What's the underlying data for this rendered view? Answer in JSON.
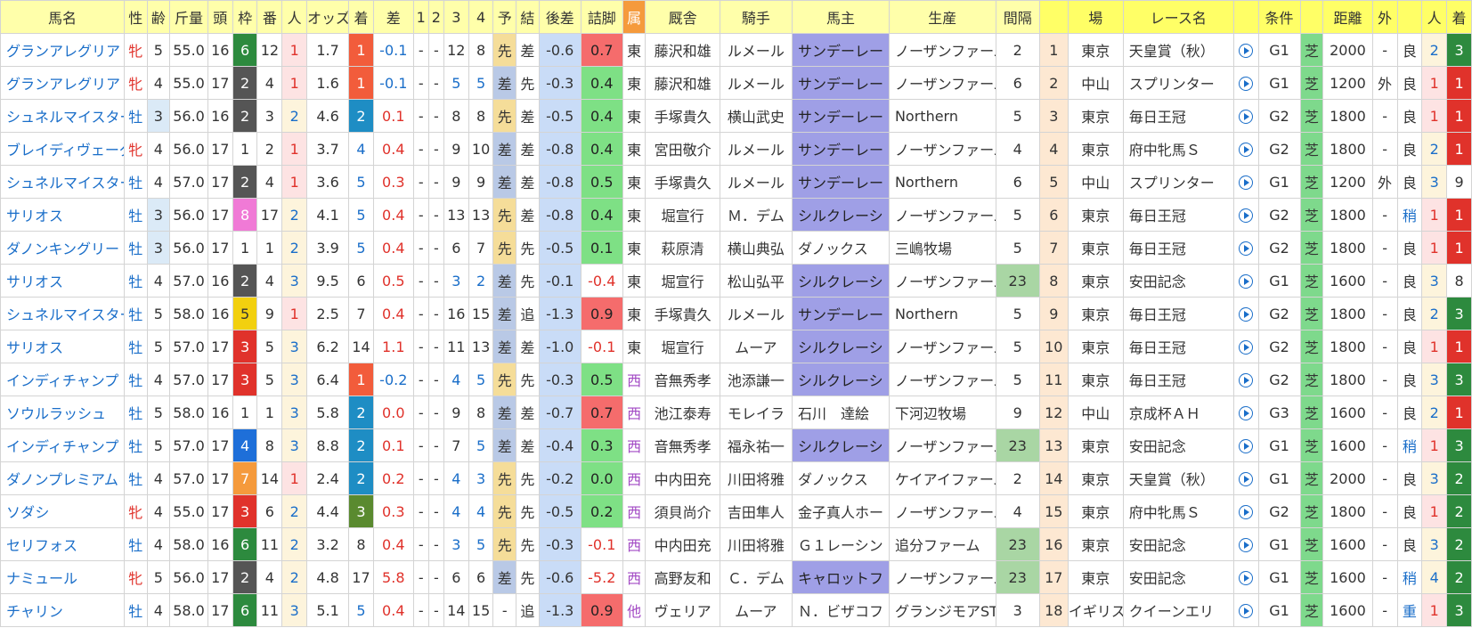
{
  "headers": [
    "馬名",
    "性",
    "齢",
    "斤量",
    "頭",
    "枠",
    "番",
    "人",
    "オッズ",
    "着",
    "差",
    "1",
    "2",
    "3",
    "4",
    "予",
    "結",
    "後差",
    "詰脚",
    "属",
    "厩舎",
    "騎手",
    "馬主",
    "生産",
    "間隔",
    "",
    "場",
    "レース名",
    "",
    "条件",
    "",
    "距離",
    "外",
    "",
    "人",
    "着"
  ],
  "colors": {
    "frame": {
      "1": "#ffffff",
      "2": "#555555",
      "3": "#e0322b",
      "4": "#1e6fd9",
      "5": "#f2d00f",
      "6": "#2d8a3e",
      "7": "#f59a3c",
      "8": "#f07ad6"
    },
    "frame_text": {
      "1": "#333333",
      "2": "#ffffff",
      "3": "#ffffff",
      "4": "#ffffff",
      "5": "#333333",
      "6": "#ffffff",
      "7": "#ffffff",
      "8": "#ffffff"
    }
  },
  "rows": [
    {
      "name": "グランアレグリア",
      "sex": "牝",
      "age": "5",
      "weight": "55.0",
      "heads": "16",
      "frame": "6",
      "num": "12",
      "pop": "1",
      "odds": "1.7",
      "finish": "1",
      "diff": "-0.1",
      "c1": "-",
      "c2": "-",
      "c3": "12",
      "c4": "8",
      "pred": "先",
      "res": "差",
      "gosa": "-0.6",
      "tsume": "0.7",
      "zoku": "東",
      "stable": "藤沢和雄",
      "jockey": "ルメール",
      "owner": "サンデーレー",
      "breeder": "ノーザンファーム",
      "interval": "2",
      "idx": "1",
      "venue": "東京",
      "race": "天皇賞（秋）",
      "grade": "G1",
      "surface": "芝",
      "dist": "2000",
      "out": "-",
      "baba": "良",
      "rpop": "2",
      "rfin": "3"
    },
    {
      "name": "グランアレグリア",
      "sex": "牝",
      "age": "4",
      "weight": "55.0",
      "heads": "17",
      "frame": "2",
      "num": "4",
      "pop": "1",
      "odds": "1.6",
      "finish": "1",
      "diff": "-0.1",
      "c1": "-",
      "c2": "-",
      "c3": "5",
      "c4": "5",
      "pred": "差",
      "res": "先",
      "gosa": "-0.3",
      "tsume": "0.4",
      "zoku": "東",
      "stable": "藤沢和雄",
      "jockey": "ルメール",
      "owner": "サンデーレー",
      "breeder": "ノーザンファーム",
      "interval": "6",
      "idx": "2",
      "venue": "中山",
      "race": "スプリンター",
      "grade": "G1",
      "surface": "芝",
      "dist": "1200",
      "out": "外",
      "baba": "良",
      "rpop": "1",
      "rfin": "1"
    },
    {
      "name": "シュネルマイスター",
      "sex": "牡",
      "age": "3",
      "weight": "56.0",
      "heads": "16",
      "frame": "2",
      "num": "3",
      "pop": "2",
      "odds": "4.6",
      "finish": "2",
      "diff": "0.1",
      "c1": "-",
      "c2": "-",
      "c3": "8",
      "c4": "8",
      "pred": "先",
      "res": "差",
      "gosa": "-0.5",
      "tsume": "0.4",
      "zoku": "東",
      "stable": "手塚貴久",
      "jockey": "横山武史",
      "owner": "サンデーレー",
      "breeder": "Northern",
      "interval": "5",
      "idx": "3",
      "venue": "東京",
      "race": "毎日王冠",
      "grade": "G2",
      "surface": "芝",
      "dist": "1800",
      "out": "-",
      "baba": "良",
      "rpop": "1",
      "rfin": "1"
    },
    {
      "name": "ブレイディヴェーグ",
      "sex": "牝",
      "age": "4",
      "weight": "56.0",
      "heads": "17",
      "frame": "1",
      "num": "2",
      "pop": "1",
      "odds": "3.7",
      "finish": "4",
      "diff": "0.4",
      "c1": "-",
      "c2": "-",
      "c3": "9",
      "c4": "10",
      "pred": "差",
      "res": "差",
      "gosa": "-0.8",
      "tsume": "0.4",
      "zoku": "東",
      "stable": "宮田敬介",
      "jockey": "ルメール",
      "owner": "サンデーレー",
      "breeder": "ノーザンファーム",
      "interval": "4",
      "idx": "4",
      "venue": "東京",
      "race": "府中牝馬Ｓ",
      "grade": "G2",
      "surface": "芝",
      "dist": "1800",
      "out": "-",
      "baba": "良",
      "rpop": "2",
      "rfin": "1"
    },
    {
      "name": "シュネルマイスター",
      "sex": "牡",
      "age": "4",
      "weight": "57.0",
      "heads": "17",
      "frame": "2",
      "num": "4",
      "pop": "1",
      "odds": "3.6",
      "finish": "5",
      "diff": "0.3",
      "c1": "-",
      "c2": "-",
      "c3": "9",
      "c4": "9",
      "pred": "差",
      "res": "差",
      "gosa": "-0.8",
      "tsume": "0.5",
      "zoku": "東",
      "stable": "手塚貴久",
      "jockey": "ルメール",
      "owner": "サンデーレー",
      "breeder": "Northern",
      "interval": "6",
      "idx": "5",
      "venue": "中山",
      "race": "スプリンター",
      "grade": "G1",
      "surface": "芝",
      "dist": "1200",
      "out": "外",
      "baba": "良",
      "rpop": "3",
      "rfin": "9"
    },
    {
      "name": "サリオス",
      "sex": "牡",
      "age": "3",
      "weight": "56.0",
      "heads": "17",
      "frame": "8",
      "num": "17",
      "pop": "2",
      "odds": "4.1",
      "finish": "5",
      "diff": "0.4",
      "c1": "-",
      "c2": "-",
      "c3": "13",
      "c4": "13",
      "pred": "先",
      "res": "差",
      "gosa": "-0.8",
      "tsume": "0.4",
      "zoku": "東",
      "stable": "堀宣行",
      "jockey": "Ｍ．デム",
      "owner": "シルクレーシ",
      "breeder": "ノーザンファーム",
      "interval": "5",
      "idx": "6",
      "venue": "東京",
      "race": "毎日王冠",
      "grade": "G2",
      "surface": "芝",
      "dist": "1800",
      "out": "-",
      "baba": "稍",
      "rpop": "1",
      "rfin": "1"
    },
    {
      "name": "ダノンキングリー",
      "sex": "牡",
      "age": "3",
      "weight": "56.0",
      "heads": "17",
      "frame": "1",
      "num": "1",
      "pop": "2",
      "odds": "3.9",
      "finish": "5",
      "diff": "0.4",
      "c1": "-",
      "c2": "-",
      "c3": "6",
      "c4": "7",
      "pred": "先",
      "res": "先",
      "gosa": "-0.5",
      "tsume": "0.1",
      "zoku": "東",
      "stable": "萩原清",
      "jockey": "横山典弘",
      "owner": "ダノックス",
      "breeder": "三嶋牧場",
      "interval": "5",
      "idx": "7",
      "venue": "東京",
      "race": "毎日王冠",
      "grade": "G2",
      "surface": "芝",
      "dist": "1800",
      "out": "-",
      "baba": "良",
      "rpop": "1",
      "rfin": "1"
    },
    {
      "name": "サリオス",
      "sex": "牡",
      "age": "4",
      "weight": "57.0",
      "heads": "16",
      "frame": "2",
      "num": "4",
      "pop": "3",
      "odds": "9.5",
      "finish": "6",
      "diff": "0.5",
      "c1": "-",
      "c2": "-",
      "c3": "3",
      "c4": "2",
      "pred": "差",
      "res": "先",
      "gosa": "-0.1",
      "tsume": "-0.4",
      "zoku": "東",
      "stable": "堀宣行",
      "jockey": "松山弘平",
      "owner": "シルクレーシ",
      "breeder": "ノーザンファーム",
      "interval": "23",
      "idx": "8",
      "venue": "東京",
      "race": "安田記念",
      "grade": "G1",
      "surface": "芝",
      "dist": "1600",
      "out": "-",
      "baba": "良",
      "rpop": "3",
      "rfin": "8"
    },
    {
      "name": "シュネルマイスター",
      "sex": "牡",
      "age": "5",
      "weight": "58.0",
      "heads": "16",
      "frame": "5",
      "num": "9",
      "pop": "1",
      "odds": "2.5",
      "finish": "7",
      "diff": "0.4",
      "c1": "-",
      "c2": "-",
      "c3": "16",
      "c4": "15",
      "pred": "差",
      "res": "追",
      "gosa": "-1.3",
      "tsume": "0.9",
      "zoku": "東",
      "stable": "手塚貴久",
      "jockey": "ルメール",
      "owner": "サンデーレー",
      "breeder": "Northern",
      "interval": "5",
      "idx": "9",
      "venue": "東京",
      "race": "毎日王冠",
      "grade": "G2",
      "surface": "芝",
      "dist": "1800",
      "out": "-",
      "baba": "良",
      "rpop": "2",
      "rfin": "3"
    },
    {
      "name": "サリオス",
      "sex": "牡",
      "age": "5",
      "weight": "57.0",
      "heads": "17",
      "frame": "3",
      "num": "5",
      "pop": "3",
      "odds": "6.2",
      "finish": "14",
      "diff": "1.1",
      "c1": "-",
      "c2": "-",
      "c3": "11",
      "c4": "13",
      "pred": "差",
      "res": "差",
      "gosa": "-1.0",
      "tsume": "-0.1",
      "zoku": "東",
      "stable": "堀宣行",
      "jockey": "ムーア",
      "owner": "シルクレーシ",
      "breeder": "ノーザンファーム",
      "interval": "5",
      "idx": "10",
      "venue": "東京",
      "race": "毎日王冠",
      "grade": "G2",
      "surface": "芝",
      "dist": "1800",
      "out": "-",
      "baba": "良",
      "rpop": "1",
      "rfin": "1"
    },
    {
      "name": "インディチャンプ",
      "sex": "牡",
      "age": "4",
      "weight": "57.0",
      "heads": "17",
      "frame": "3",
      "num": "5",
      "pop": "3",
      "odds": "6.4",
      "finish": "1",
      "diff": "-0.2",
      "c1": "-",
      "c2": "-",
      "c3": "4",
      "c4": "5",
      "pred": "先",
      "res": "先",
      "gosa": "-0.3",
      "tsume": "0.5",
      "zoku": "西",
      "stable": "音無秀孝",
      "jockey": "池添謙一",
      "owner": "シルクレーシ",
      "breeder": "ノーザンファーム",
      "interval": "5",
      "idx": "11",
      "venue": "東京",
      "race": "毎日王冠",
      "grade": "G2",
      "surface": "芝",
      "dist": "1800",
      "out": "-",
      "baba": "良",
      "rpop": "3",
      "rfin": "3"
    },
    {
      "name": "ソウルラッシュ",
      "sex": "牡",
      "age": "5",
      "weight": "58.0",
      "heads": "16",
      "frame": "1",
      "num": "1",
      "pop": "3",
      "odds": "5.8",
      "finish": "2",
      "diff": "0.0",
      "c1": "-",
      "c2": "-",
      "c3": "9",
      "c4": "8",
      "pred": "差",
      "res": "差",
      "gosa": "-0.7",
      "tsume": "0.7",
      "zoku": "西",
      "stable": "池江泰寿",
      "jockey": "モレイラ",
      "owner": "石川　達絵",
      "breeder": "下河辺牧場",
      "interval": "9",
      "idx": "12",
      "venue": "中山",
      "race": "京成杯ＡＨ",
      "grade": "G3",
      "surface": "芝",
      "dist": "1600",
      "out": "-",
      "baba": "良",
      "rpop": "2",
      "rfin": "1"
    },
    {
      "name": "インディチャンプ",
      "sex": "牡",
      "age": "5",
      "weight": "57.0",
      "heads": "17",
      "frame": "4",
      "num": "8",
      "pop": "3",
      "odds": "8.8",
      "finish": "2",
      "diff": "0.1",
      "c1": "-",
      "c2": "-",
      "c3": "7",
      "c4": "5",
      "pred": "差",
      "res": "差",
      "gosa": "-0.4",
      "tsume": "0.3",
      "zoku": "西",
      "stable": "音無秀孝",
      "jockey": "福永祐一",
      "owner": "シルクレーシ",
      "breeder": "ノーザンファーム",
      "interval": "23",
      "idx": "13",
      "venue": "東京",
      "race": "安田記念",
      "grade": "G1",
      "surface": "芝",
      "dist": "1600",
      "out": "-",
      "baba": "稍",
      "rpop": "1",
      "rfin": "3"
    },
    {
      "name": "ダノンプレミアム",
      "sex": "牡",
      "age": "4",
      "weight": "57.0",
      "heads": "17",
      "frame": "7",
      "num": "14",
      "pop": "1",
      "odds": "2.4",
      "finish": "2",
      "diff": "0.2",
      "c1": "-",
      "c2": "-",
      "c3": "4",
      "c4": "3",
      "pred": "先",
      "res": "先",
      "gosa": "-0.2",
      "tsume": "0.0",
      "zoku": "西",
      "stable": "中内田充",
      "jockey": "川田将雅",
      "owner": "ダノックス",
      "breeder": "ケイアイファーム",
      "interval": "2",
      "idx": "14",
      "venue": "東京",
      "race": "天皇賞（秋）",
      "grade": "G1",
      "surface": "芝",
      "dist": "2000",
      "out": "-",
      "baba": "良",
      "rpop": "3",
      "rfin": "2"
    },
    {
      "name": "ソダシ",
      "sex": "牝",
      "age": "4",
      "weight": "55.0",
      "heads": "17",
      "frame": "3",
      "num": "6",
      "pop": "2",
      "odds": "4.4",
      "finish": "3",
      "diff": "0.3",
      "c1": "-",
      "c2": "-",
      "c3": "4",
      "c4": "4",
      "pred": "先",
      "res": "先",
      "gosa": "-0.5",
      "tsume": "0.2",
      "zoku": "西",
      "stable": "須貝尚介",
      "jockey": "吉田隼人",
      "owner": "金子真人ホー",
      "breeder": "ノーザンファーム",
      "interval": "4",
      "idx": "15",
      "venue": "東京",
      "race": "府中牝馬Ｓ",
      "grade": "G2",
      "surface": "芝",
      "dist": "1800",
      "out": "-",
      "baba": "良",
      "rpop": "1",
      "rfin": "2"
    },
    {
      "name": "セリフォス",
      "sex": "牡",
      "age": "4",
      "weight": "58.0",
      "heads": "16",
      "frame": "6",
      "num": "11",
      "pop": "2",
      "odds": "3.2",
      "finish": "8",
      "diff": "0.4",
      "c1": "-",
      "c2": "-",
      "c3": "3",
      "c4": "5",
      "pred": "先",
      "res": "先",
      "gosa": "-0.3",
      "tsume": "-0.1",
      "zoku": "西",
      "stable": "中内田充",
      "jockey": "川田将雅",
      "owner": "Ｇ１レーシン",
      "breeder": "追分ファーム",
      "interval": "23",
      "idx": "16",
      "venue": "東京",
      "race": "安田記念",
      "grade": "G1",
      "surface": "芝",
      "dist": "1600",
      "out": "-",
      "baba": "良",
      "rpop": "3",
      "rfin": "2"
    },
    {
      "name": "ナミュール",
      "sex": "牝",
      "age": "5",
      "weight": "56.0",
      "heads": "17",
      "frame": "2",
      "num": "4",
      "pop": "2",
      "odds": "4.8",
      "finish": "17",
      "diff": "5.8",
      "c1": "-",
      "c2": "-",
      "c3": "6",
      "c4": "6",
      "pred": "差",
      "res": "先",
      "gosa": "-0.6",
      "tsume": "-5.2",
      "zoku": "西",
      "stable": "高野友和",
      "jockey": "Ｃ．デム",
      "owner": "キャロットフ",
      "breeder": "ノーザンファーム",
      "interval": "23",
      "idx": "17",
      "venue": "東京",
      "race": "安田記念",
      "grade": "G1",
      "surface": "芝",
      "dist": "1600",
      "out": "-",
      "baba": "稍",
      "rpop": "4",
      "rfin": "2"
    },
    {
      "name": "チャリン",
      "sex": "牡",
      "age": "4",
      "weight": "58.0",
      "heads": "17",
      "frame": "6",
      "num": "11",
      "pop": "3",
      "odds": "5.1",
      "finish": "5",
      "diff": "0.4",
      "c1": "-",
      "c2": "-",
      "c3": "14",
      "c4": "15",
      "pred": "-",
      "res": "追",
      "gosa": "-1.3",
      "tsume": "0.9",
      "zoku": "他",
      "stable": "ヴェリア",
      "jockey": "ムーア",
      "owner": "Ｎ．ビザコフ",
      "breeder": "グランジモアST",
      "interval": "3",
      "idx": "18",
      "venue": "イギリス",
      "race": "クイーンエリ",
      "grade": "G1",
      "surface": "芝",
      "dist": "1600",
      "out": "-",
      "baba": "重",
      "rpop": "1",
      "rfin": "3"
    }
  ]
}
